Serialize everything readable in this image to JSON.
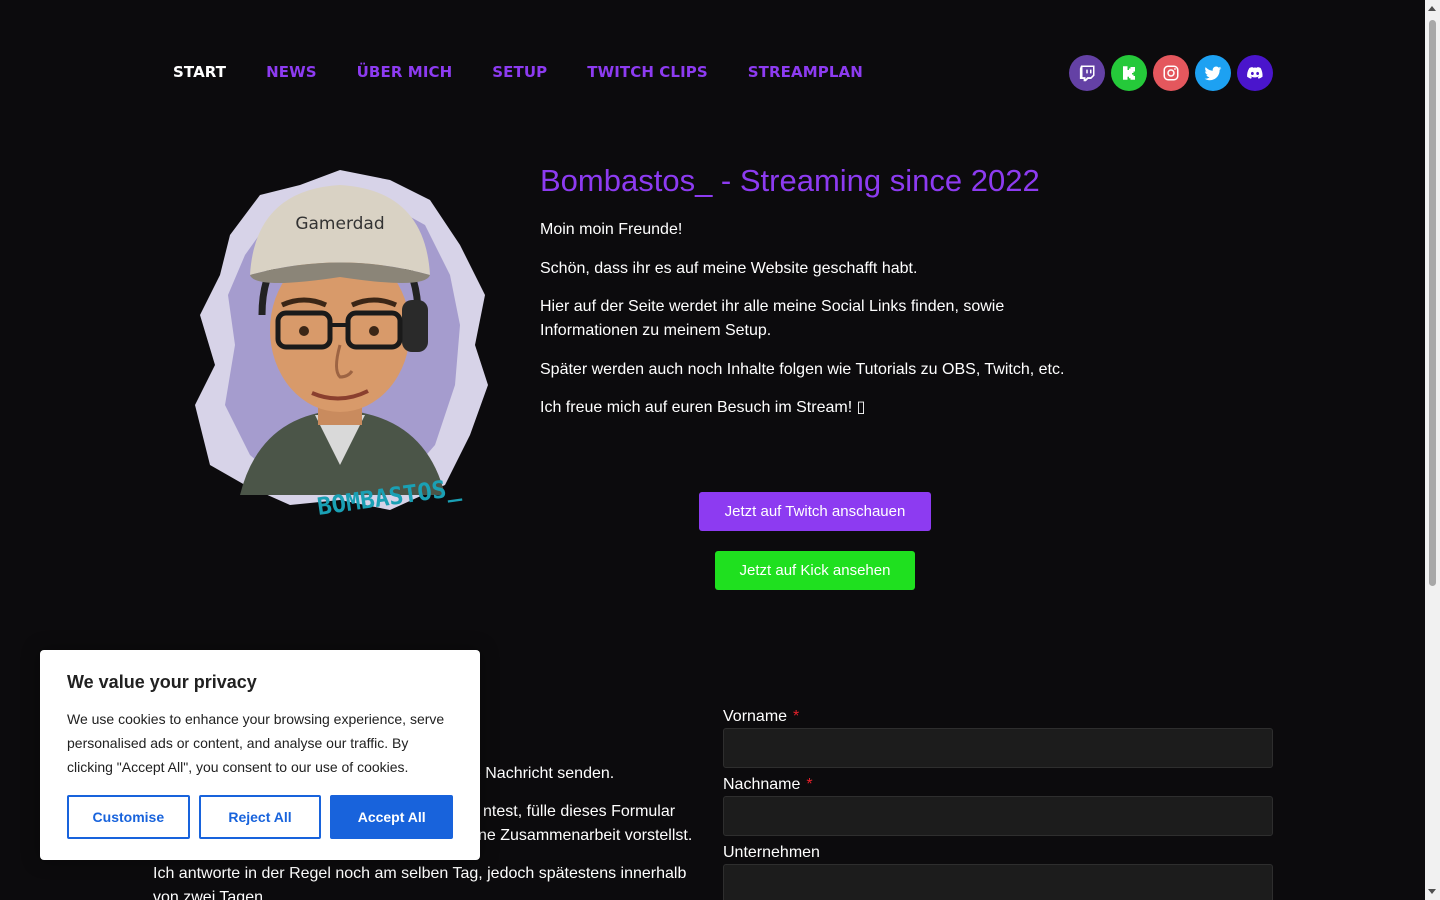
{
  "nav": {
    "items": [
      {
        "label": "START",
        "active": true
      },
      {
        "label": "NEWS"
      },
      {
        "label": "ÜBER MICH"
      },
      {
        "label": "SETUP"
      },
      {
        "label": "TWITCH CLIPS"
      },
      {
        "label": "STREAMPLAN"
      }
    ]
  },
  "socials": [
    {
      "name": "twitch-icon",
      "color": "#6441a5"
    },
    {
      "name": "kick-icon",
      "color": "#25c93a"
    },
    {
      "name": "instagram-icon",
      "color": "#e4575d"
    },
    {
      "name": "twitter-icon",
      "color": "#1da1f2"
    },
    {
      "name": "discord-icon",
      "color": "#4a15cc"
    }
  ],
  "hero": {
    "title": "Bombastos_ - Streaming since 2022",
    "paragraphs": [
      "Moin moin Freunde!",
      "Schön, dass ihr es auf meine Website geschafft habt.",
      "Hier auf der Seite werdet ihr alle meine Social Links finden, sowie Informationen zu meinem Setup.",
      "Später werden auch noch Inhalte folgen wie Tutorials zu OBS, Twitch, etc.",
      "Ich freue mich auf euren Besuch im Stream! ▯"
    ],
    "avatar_cap_text": "Gamerdad",
    "avatar_signature": "BOMBASTOS_",
    "twitch_button": "Jetzt auf Twitch anschauen",
    "kick_button": "Jetzt auf Kick ansehen"
  },
  "contact": {
    "paragraphs": [
      "ne Nachricht senden.",
      "ntest, fülle dieses Formular",
      "ne Zusammenarbeit vorstellst.",
      "Ich antworte in der Regel noch am selben Tag, jedoch spätestens innerhalb",
      "von zwei Tagen."
    ]
  },
  "form": {
    "first_name_label": "Vorname",
    "last_name_label": "Nachname",
    "company_label": "Unternehmen",
    "required_mark": "*"
  },
  "cookie": {
    "title": "We value your privacy",
    "text": "We use cookies to enhance your browsing experience, serve personalised ads or content, and analyse our traffic. By clicking \"Accept All\", you consent to our use of cookies.",
    "customise": "Customise",
    "reject": "Reject All",
    "accept": "Accept All"
  },
  "colors": {
    "accent": "#8d3bf1",
    "kick_green": "#1fe01f",
    "cookie_blue": "#1863dc"
  }
}
